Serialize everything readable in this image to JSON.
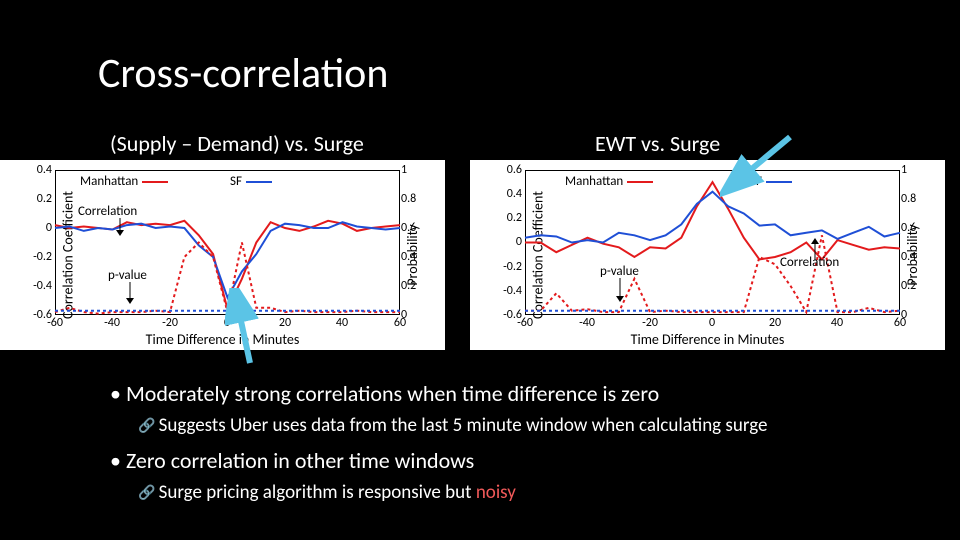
{
  "title": "Cross-correlation",
  "subtitle_left": "(Supply – Demand) vs. Surge",
  "subtitle_right": "EWT vs. Surge",
  "y_axis_left": "Correlation Coefficient",
  "y_axis_right": "Probability",
  "x_axis": "Time Difference in Minutes",
  "legend": {
    "manhattan": "Manhattan",
    "sf": "SF"
  },
  "annotations": {
    "correlation": "Correlation",
    "pvalue": "p-value"
  },
  "bullets": [
    {
      "text": "Moderately strong correlations when time difference is zero",
      "sub": "Suggests Uber uses data from the last 5 minute window when calculating surge"
    },
    {
      "text": "Zero correlation in other time windows",
      "sub_prefix": "Surge pricing algorithm is ",
      "sub_responsive": "responsive",
      "sub_mid": " but ",
      "sub_noisy": "noisy"
    }
  ],
  "chart_data": [
    {
      "type": "line",
      "title": "(Supply – Demand) vs. Surge",
      "xlabel": "Time Difference in Minutes",
      "ylabel_left": "Correlation Coefficient",
      "ylabel_right": "Probability",
      "xlim": [
        -60,
        60
      ],
      "ylim_left": [
        -0.6,
        0.4
      ],
      "ylim_right": [
        0,
        1
      ],
      "x": [
        -60,
        -55,
        -50,
        -45,
        -40,
        -35,
        -30,
        -25,
        -20,
        -15,
        -10,
        -5,
        0,
        5,
        10,
        15,
        20,
        25,
        30,
        35,
        40,
        45,
        50,
        55,
        60
      ],
      "series": [
        {
          "name": "Manhattan correlation",
          "axis": "left",
          "style": "solid",
          "color": "#e31a1c",
          "values": [
            0.02,
            0.0,
            0.01,
            0.0,
            -0.01,
            0.04,
            0.02,
            0.03,
            0.02,
            0.05,
            -0.05,
            -0.18,
            -0.56,
            -0.35,
            -0.1,
            0.04,
            0.0,
            -0.02,
            0.01,
            0.05,
            0.03,
            -0.02,
            0.0,
            0.01,
            0.02
          ]
        },
        {
          "name": "SF correlation",
          "axis": "left",
          "style": "solid",
          "color": "#1f4fd6",
          "values": [
            0.0,
            0.01,
            -0.02,
            0.0,
            -0.01,
            0.02,
            0.03,
            0.0,
            0.01,
            0.0,
            -0.12,
            -0.2,
            -0.48,
            -0.3,
            -0.18,
            -0.02,
            0.03,
            0.02,
            0.0,
            0.0,
            0.04,
            0.01,
            0.0,
            -0.01,
            0.0
          ]
        },
        {
          "name": "Manhattan p-value",
          "axis": "right",
          "style": "dashed",
          "color": "#e31a1c",
          "values": [
            0.02,
            0.05,
            0.02,
            0.01,
            0.02,
            0.02,
            0.02,
            0.03,
            0.02,
            0.4,
            0.5,
            0.4,
            0.02,
            0.5,
            0.05,
            0.05,
            0.02,
            0.03,
            0.02,
            0.02,
            0.02,
            0.03,
            0.02,
            0.02,
            0.02
          ]
        },
        {
          "name": "SF p-value",
          "axis": "right",
          "style": "dashed",
          "color": "#1f4fd6",
          "values": [
            0.03,
            0.03,
            0.03,
            0.03,
            0.03,
            0.03,
            0.03,
            0.03,
            0.03,
            0.03,
            0.03,
            0.03,
            0.03,
            0.03,
            0.03,
            0.03,
            0.03,
            0.03,
            0.03,
            0.03,
            0.03,
            0.03,
            0.03,
            0.03,
            0.03
          ]
        }
      ],
      "legend_position": "top",
      "annotations": [
        {
          "text": "Correlation",
          "at": [
            -35,
            0.1
          ]
        },
        {
          "text": "p-value",
          "at": [
            -30,
            -0.3
          ]
        }
      ]
    },
    {
      "type": "line",
      "title": "EWT vs. Surge",
      "xlabel": "Time Difference in Minutes",
      "ylabel_left": "Correlation Coefficient",
      "ylabel_right": "Probability",
      "xlim": [
        -60,
        60
      ],
      "ylim_left": [
        -0.6,
        0.6
      ],
      "ylim_right": [
        0,
        1
      ],
      "x": [
        -60,
        -55,
        -50,
        -45,
        -40,
        -35,
        -30,
        -25,
        -20,
        -15,
        -10,
        -5,
        0,
        5,
        10,
        15,
        20,
        25,
        30,
        35,
        40,
        45,
        50,
        55,
        60
      ],
      "series": [
        {
          "name": "Manhattan correlation",
          "axis": "left",
          "style": "solid",
          "color": "#e31a1c",
          "values": [
            0.0,
            0.0,
            -0.08,
            -0.02,
            0.04,
            -0.01,
            -0.04,
            -0.12,
            -0.04,
            -0.05,
            0.04,
            0.3,
            0.5,
            0.28,
            0.04,
            -0.14,
            -0.12,
            -0.08,
            0.0,
            -0.14,
            0.02,
            -0.02,
            -0.06,
            -0.04,
            -0.05
          ]
        },
        {
          "name": "SF correlation",
          "axis": "left",
          "style": "solid",
          "color": "#1f4fd6",
          "values": [
            0.04,
            0.06,
            0.05,
            0.0,
            0.02,
            0.0,
            0.08,
            0.06,
            0.02,
            0.06,
            0.15,
            0.32,
            0.42,
            0.3,
            0.24,
            0.14,
            0.15,
            0.06,
            0.08,
            0.1,
            0.03,
            0.08,
            0.13,
            0.05,
            0.08
          ]
        },
        {
          "name": "Manhattan p-value",
          "axis": "right",
          "style": "dashed",
          "color": "#e31a1c",
          "values": [
            0.03,
            0.03,
            0.15,
            0.03,
            0.04,
            0.02,
            0.02,
            0.25,
            0.02,
            0.03,
            0.02,
            0.02,
            0.02,
            0.02,
            0.02,
            0.4,
            0.35,
            0.2,
            0.02,
            0.55,
            0.02,
            0.02,
            0.05,
            0.02,
            0.03
          ]
        },
        {
          "name": "SF p-value",
          "axis": "right",
          "style": "dashed",
          "color": "#1f4fd6",
          "values": [
            0.03,
            0.03,
            0.03,
            0.03,
            0.03,
            0.03,
            0.03,
            0.03,
            0.03,
            0.03,
            0.03,
            0.03,
            0.03,
            0.03,
            0.03,
            0.03,
            0.03,
            0.03,
            0.03,
            0.03,
            0.03,
            0.03,
            0.03,
            0.03,
            0.03
          ]
        }
      ],
      "legend_position": "top",
      "annotations": [
        {
          "text": "p-value",
          "at": [
            -25,
            -0.25
          ]
        },
        {
          "text": "Correlation",
          "at": [
            35,
            -0.2
          ]
        }
      ]
    }
  ],
  "colors": {
    "manhattan": "#e31a1c",
    "sf": "#1f4fd6",
    "callout": "#4fc3f7"
  }
}
